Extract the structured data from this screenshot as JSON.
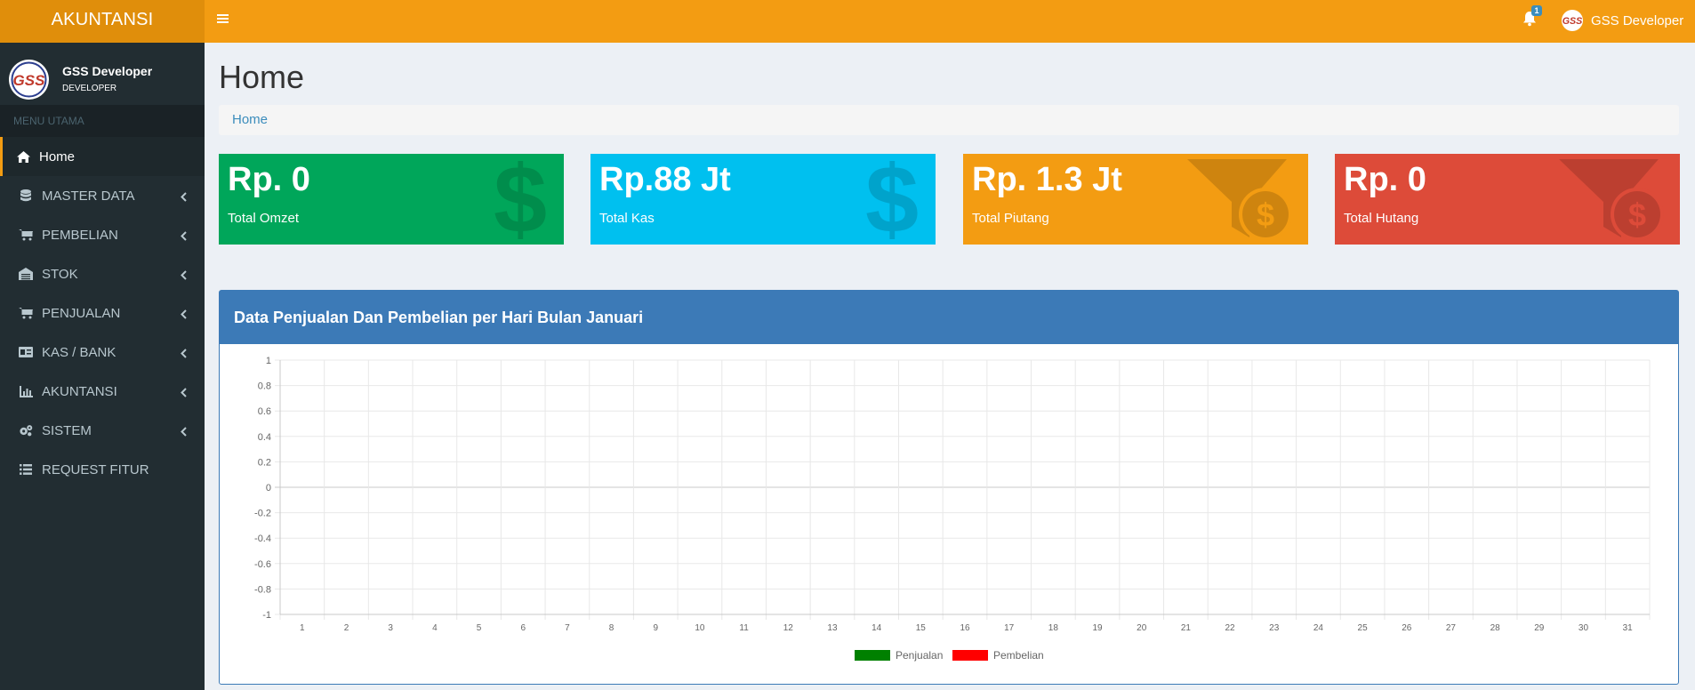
{
  "header": {
    "logo_text": "AKUNTANSI",
    "notification_count": "1",
    "user_name": "GSS Developer"
  },
  "sidebar": {
    "user_name": "GSS Developer",
    "user_role": "DEVELOPER",
    "menu_header": "MENU UTAMA",
    "items": [
      {
        "label": "Home",
        "icon": "home-icon",
        "active": true
      },
      {
        "label": "MASTER DATA",
        "icon": "database-icon",
        "active": false
      },
      {
        "label": "PEMBELIAN",
        "icon": "cart-plus-icon",
        "active": false
      },
      {
        "label": "STOK",
        "icon": "warehouse-icon",
        "active": false
      },
      {
        "label": "PENJUALAN",
        "icon": "cart-icon",
        "active": false
      },
      {
        "label": "KAS / BANK",
        "icon": "money-card-icon",
        "active": false
      },
      {
        "label": "AKUNTANSI",
        "icon": "line-chart-icon",
        "active": false
      },
      {
        "label": "SISTEM",
        "icon": "gears-icon",
        "active": false
      },
      {
        "label": "REQUEST FITUR",
        "icon": "list-icon",
        "active": false
      }
    ]
  },
  "content": {
    "title": "Home",
    "breadcrumb": "Home"
  },
  "stats": [
    {
      "value": "Rp. 0",
      "label": "Total Omzet",
      "color": "#00a65a",
      "icon": "dollar-icon"
    },
    {
      "value": "Rp.88 Jt",
      "label": "Total Kas",
      "color": "#00c0ef",
      "icon": "dollar-icon"
    },
    {
      "value": "Rp. 1.3 Jt",
      "label": "Total Piutang",
      "color": "#f39c12",
      "icon": "funnel-dollar-icon"
    },
    {
      "value": "Rp. 0",
      "label": "Total Hutang",
      "color": "#dd4b39",
      "icon": "funnel-dollar-icon"
    }
  ],
  "chart_panel": {
    "title": "Data Penjualan Dan Pembelian per Hari Bulan Januari"
  },
  "chart_data": {
    "type": "bar",
    "categories": [
      "1",
      "2",
      "3",
      "4",
      "5",
      "6",
      "7",
      "8",
      "9",
      "10",
      "11",
      "12",
      "13",
      "14",
      "15",
      "16",
      "17",
      "18",
      "19",
      "20",
      "21",
      "22",
      "23",
      "24",
      "25",
      "26",
      "27",
      "28",
      "29",
      "30",
      "31"
    ],
    "series": [
      {
        "name": "Penjualan",
        "color": "#008000",
        "values": [
          0,
          0,
          0,
          0,
          0,
          0,
          0,
          0,
          0,
          0,
          0,
          0,
          0,
          0,
          0,
          0,
          0,
          0,
          0,
          0,
          0,
          0,
          0,
          0,
          0,
          0,
          0,
          0,
          0,
          0,
          0
        ]
      },
      {
        "name": "Pembelian",
        "color": "#ff0000",
        "values": [
          0,
          0,
          0,
          0,
          0,
          0,
          0,
          0,
          0,
          0,
          0,
          0,
          0,
          0,
          0,
          0,
          0,
          0,
          0,
          0,
          0,
          0,
          0,
          0,
          0,
          0,
          0,
          0,
          0,
          0,
          0
        ]
      }
    ],
    "yticks": [
      "1",
      "0.8",
      "0.6",
      "0.4",
      "0.2",
      "0",
      "-0.2",
      "-0.4",
      "-0.6",
      "-0.8",
      "-1"
    ],
    "ylim": [
      -1,
      1
    ],
    "grid": true,
    "legend_position": "bottom"
  }
}
